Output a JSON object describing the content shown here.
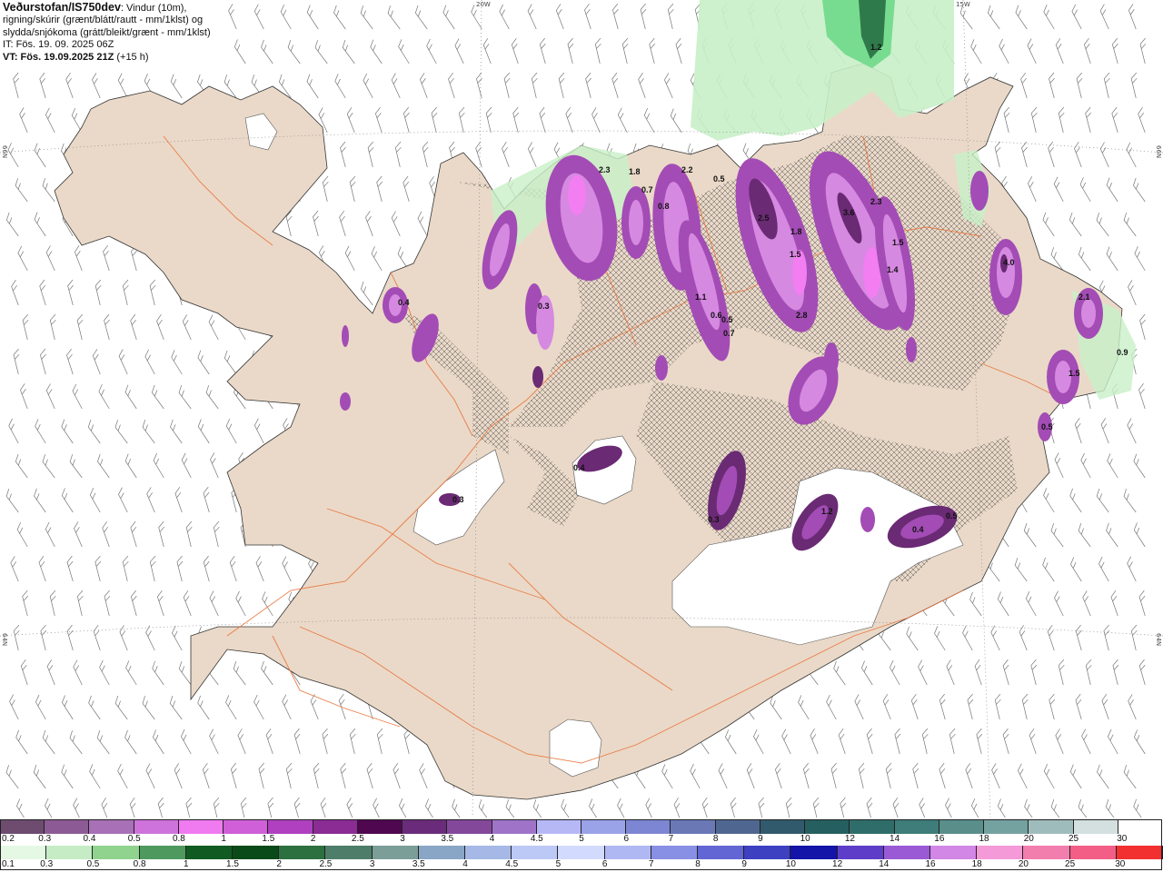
{
  "header": {
    "source": "Veðurstofan/IS750dev",
    "description_1": ": Vindur (10m),",
    "description_2": "rigning/skúrir (grænt/blátt/rautt - mm/1klst) og",
    "description_3": "slydda/snjókoma (grátt/bleikt/grænt - mm/1klst)",
    "issue_time": "IT: Fös. 19. 09. 2025 06Z",
    "valid_prefix": "VT: Fös. 19.09.2025 21Z",
    "valid_suffix": " (+15 h)"
  },
  "coordinates": {
    "top_left": "20W",
    "top_right": "15W",
    "left_upper": "66N",
    "right_upper": "66N",
    "left_lower": "64N",
    "right_lower": "64N"
  },
  "colors": {
    "land": "#ead9c8",
    "sea": "#ffffff",
    "glacier": "#ffffff",
    "roads": "#e8733a",
    "coast": "#333333",
    "rain_light": "#c8f0c8",
    "rain_mid": "#6fd98a",
    "rain_heavy": "#2f7a4a",
    "snow_light": "#d689e0",
    "snow_mid": "#a34cb5",
    "snow_heavy": "#6a2a74",
    "snow_pink": "#f27ef2"
  },
  "precip_labels": [
    {
      "text": "1.2"
    },
    {
      "text": "0.7"
    },
    {
      "text": "0.5"
    },
    {
      "text": "0.8"
    },
    {
      "text": "2.3"
    },
    {
      "text": "1.8"
    },
    {
      "text": "1.5"
    },
    {
      "text": "1.1"
    },
    {
      "text": "2.2"
    },
    {
      "text": "2.5"
    },
    {
      "text": "3.6"
    },
    {
      "text": "2.3"
    },
    {
      "text": "1.8"
    },
    {
      "text": "1.5"
    },
    {
      "text": "1.4"
    },
    {
      "text": "2.8"
    },
    {
      "text": "0.6"
    },
    {
      "text": "0.5"
    },
    {
      "text": "0.7"
    },
    {
      "text": "0.4"
    },
    {
      "text": "0.3"
    },
    {
      "text": "4.0"
    },
    {
      "text": "2.1"
    },
    {
      "text": "1.5"
    },
    {
      "text": "0.5"
    },
    {
      "text": "0.9"
    },
    {
      "text": "0.4"
    },
    {
      "text": "0.5"
    },
    {
      "text": "1.2"
    },
    {
      "text": "0.3"
    },
    {
      "text": "0.4"
    },
    {
      "text": "0.3"
    }
  ],
  "legend": {
    "snow_scale": {
      "labels": [
        "0.2",
        "0.3",
        "0.4",
        "0.5",
        "0.8",
        "1",
        "1.5",
        "2",
        "2.5",
        "3",
        "3.5",
        "4",
        "4.5",
        "5",
        "6",
        "7",
        "8",
        "9",
        "10",
        "12",
        "14",
        "16",
        "18",
        "20",
        "25",
        "30"
      ],
      "colors": [
        "#6d4c70",
        "#8c5a94",
        "#a870b6",
        "#cf73dc",
        "#f07af0",
        "#cf60d8",
        "#b040c0",
        "#8a2c94",
        "#4f0750",
        "#6a2c7a",
        "#84489a",
        "#9f74c8",
        "#b6b8f6",
        "#9aa2e8",
        "#7d86d3",
        "#6a78b6",
        "#4f6790",
        "#315a6c",
        "#255f60",
        "#2e6d6a",
        "#3e7d79",
        "#5a8e8a",
        "#74a2a0",
        "#9fbcbc",
        "#d4e0e0"
      ]
    },
    "rain_scale": {
      "labels": [
        "0.1",
        "0.3",
        "0.5",
        "0.8",
        "1",
        "1.5",
        "2",
        "2.5",
        "3",
        "3.5",
        "4",
        "4.5",
        "5",
        "6",
        "7",
        "8",
        "9",
        "10",
        "12",
        "14",
        "16",
        "18",
        "20",
        "25",
        "30"
      ],
      "colors": [
        "#e4f8e4",
        "#c6ecc6",
        "#8fd38f",
        "#4e9a5e",
        "#115b22",
        "#0a4a18",
        "#2c7040",
        "#4e7e6a",
        "#7c9e98",
        "#8aa6c6",
        "#a6b8e6",
        "#bcc8f6",
        "#d2dafe",
        "#b0b8f4",
        "#8890e6",
        "#6266d4",
        "#3e40c2",
        "#1414a8",
        "#5e3ec8",
        "#9a5ad6",
        "#d286e6",
        "#f49ad8",
        "#f27eae",
        "#f25e86",
        "#f23030",
        "#f21010"
      ]
    }
  }
}
